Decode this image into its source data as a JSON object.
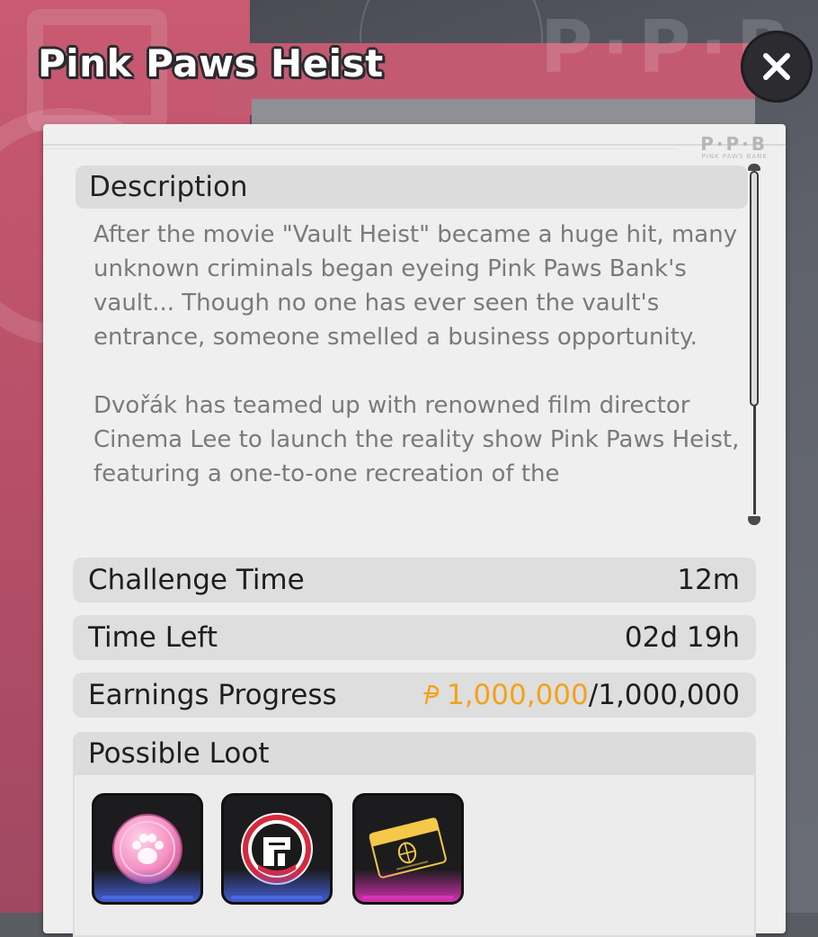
{
  "background": {
    "watermark": "P·P·B"
  },
  "title": "Pink Paws Heist",
  "close_icon": "close-icon",
  "panel_logo": {
    "mark": "P·P·B",
    "caption": "PINK PAWS BANK"
  },
  "description": {
    "header": "Description",
    "text": "After the movie \"Vault Heist\" became a huge hit, many unknown criminals began eyeing Pink Paws Bank's vault... Though no one has ever seen the vault's entrance, someone smelled a business opportunity.\n\nDvořák has teamed up with renowned film director Cinema Lee to launch the reality show Pink Paws Heist, featuring a one-to-one recreation of the"
  },
  "stats": {
    "challenge_time": {
      "label": "Challenge Time",
      "value": "12m"
    },
    "time_left": {
      "label": "Time Left",
      "value": "02d 19h"
    },
    "earnings": {
      "label": "Earnings Progress",
      "currency_icon": "dennies-coin-icon",
      "current": "1,000,000",
      "separator": "/",
      "total": "1,000,000"
    }
  },
  "loot": {
    "header": "Possible Loot",
    "items": [
      {
        "icon": "pink-paw-coin-icon",
        "rarity_color": "#4a66e0"
      },
      {
        "icon": "ppb-badge-icon",
        "rarity_color": "#4a66e0"
      },
      {
        "icon": "ppb-card-icon",
        "rarity_color": "#d636b4"
      }
    ]
  },
  "colors": {
    "accent_orange": "#f3a21a",
    "panel_bg": "#efefef",
    "pink": "#c95a72"
  }
}
